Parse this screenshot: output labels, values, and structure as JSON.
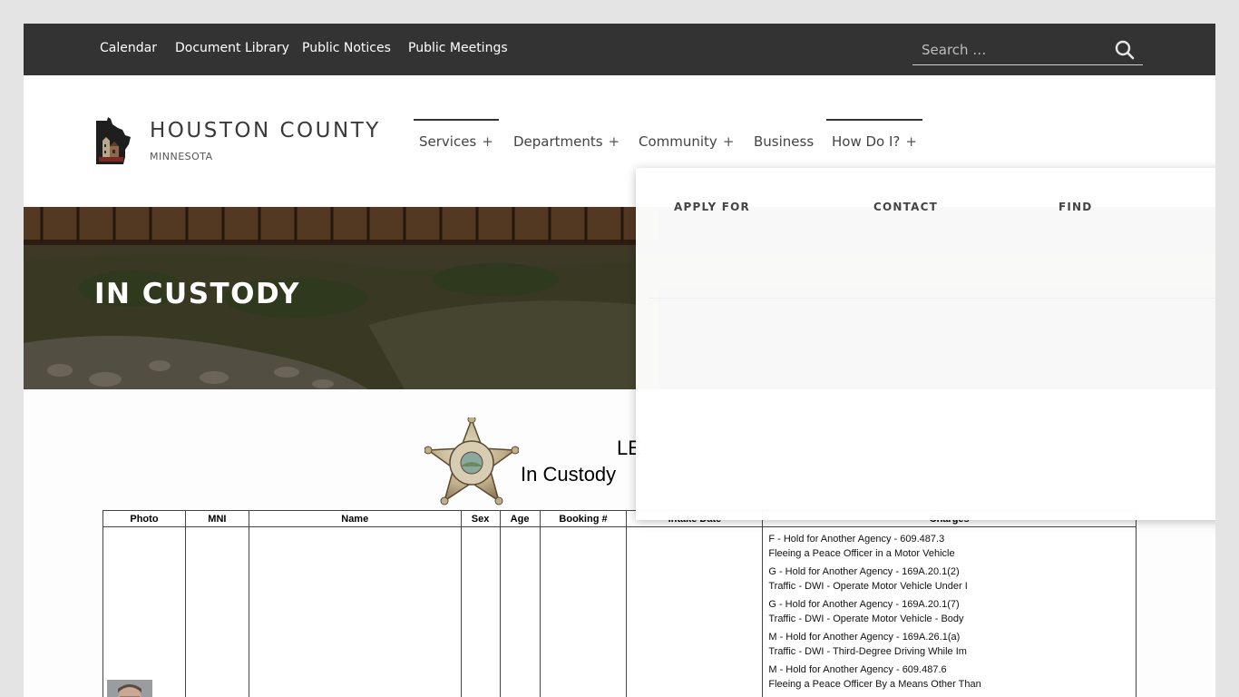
{
  "topbar": {
    "links": [
      "Calendar",
      "Document Library",
      "Public Notices",
      "Public Meetings"
    ],
    "search_placeholder": "Search …"
  },
  "header": {
    "site_title": "HOUSTON COUNTY",
    "site_subtitle": "MINNESOTA",
    "nav": [
      {
        "label": "Services",
        "has_submenu": true
      },
      {
        "label": "Departments",
        "has_submenu": true
      },
      {
        "label": "Community",
        "has_submenu": true
      },
      {
        "label": "Business",
        "has_submenu": false
      },
      {
        "label": "How Do I?",
        "has_submenu": true
      }
    ],
    "submenu_marker": "+"
  },
  "hero": {
    "title": "IN CUSTODY"
  },
  "mega_menu": {
    "columns": [
      "APPLY FOR",
      "CONTACT",
      "FIND"
    ]
  },
  "report": {
    "heading_visible": "LE",
    "subheading_visible": "In Custody"
  },
  "table": {
    "columns": [
      "Photo",
      "MNI",
      "Name",
      "Sex",
      "Age",
      "Booking #",
      "Intake Date",
      "Charges"
    ],
    "rows": [
      {
        "charges": [
          {
            "code": "F  -  Hold for Another Agency  -  609.487.3",
            "desc": "Fleeing a Peace Officer in a Motor Vehicle"
          },
          {
            "code": "G  -  Hold for Another Agency  -  169A.20.1(2)",
            "desc": "Traffic - DWI - Operate Motor Vehicle Under I"
          },
          {
            "code": "G  -  Hold for Another Agency  -  169A.20.1(7)",
            "desc": "Traffic - DWI - Operate Motor Vehicle - Body"
          },
          {
            "code": "M  -  Hold for Another Agency  -  169A.26.1(a)",
            "desc": "Traffic - DWI - Third-Degree Driving While Im"
          },
          {
            "code": "M  -  Hold for Another Agency  -  609.487.6",
            "desc": "Fleeing a Peace Officer By a Means Other Than"
          }
        ]
      }
    ]
  },
  "colors": {
    "topbar_bg": "#333333",
    "page_bg": "#e4e4e4",
    "text_dark": "#3a3a3a"
  },
  "icons": [
    "search-icon",
    "county-logo-icon",
    "sheriff-badge-icon",
    "plus-icon"
  ]
}
